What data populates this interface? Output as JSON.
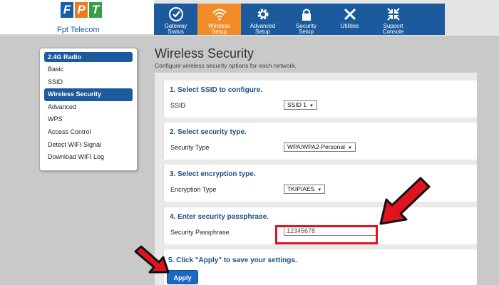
{
  "brand": {
    "logo_letters": [
      "F",
      "P",
      "T"
    ],
    "name": "Fpt Telecom"
  },
  "nav": [
    {
      "label": "Gateway\nStatus",
      "icon": "gauge-icon"
    },
    {
      "label": "Wireless\nSetup",
      "icon": "wifi-icon",
      "active": true
    },
    {
      "label": "Advanced\nSetup",
      "icon": "gear-icon"
    },
    {
      "label": "Security\nSetup",
      "icon": "lock-icon"
    },
    {
      "label": "Utilities",
      "icon": "tools-icon"
    },
    {
      "label": "Support\nConsole",
      "icon": "arrows-icon"
    }
  ],
  "sidebar": {
    "header": "2.4G Radio",
    "items": [
      {
        "label": "Basic"
      },
      {
        "label": "SSID"
      },
      {
        "label": "Wireless Security",
        "active": true
      },
      {
        "label": "Advanced"
      },
      {
        "label": "WPS"
      },
      {
        "label": "Access Control"
      },
      {
        "label": "Detect WIFI Signal"
      },
      {
        "label": "Download WIFI Log"
      }
    ]
  },
  "page": {
    "title": "Wireless Security",
    "subtitle": "Configure wireless security options for each network."
  },
  "sections": [
    {
      "title": "1. Select SSID to configure.",
      "label": "SSID",
      "value": "SSID 1"
    },
    {
      "title": "2. Select security type.",
      "label": "Security Type",
      "value": "WPA/WPA2-Personal"
    },
    {
      "title": "3. Select encryption type.",
      "label": "Encryption Type",
      "value": "TKIP/AES"
    },
    {
      "title": "4. Enter security passphrase.",
      "label": "Security Passphrase",
      "value": "12345678"
    }
  ],
  "apply": {
    "instruction": "5. Click \"Apply\" to save your settings.",
    "button_label": "Apply"
  },
  "colors": {
    "nav_blue": "#1c5a9e",
    "nav_active_orange": "#f28c28",
    "highlight_red": "#e0141e"
  }
}
